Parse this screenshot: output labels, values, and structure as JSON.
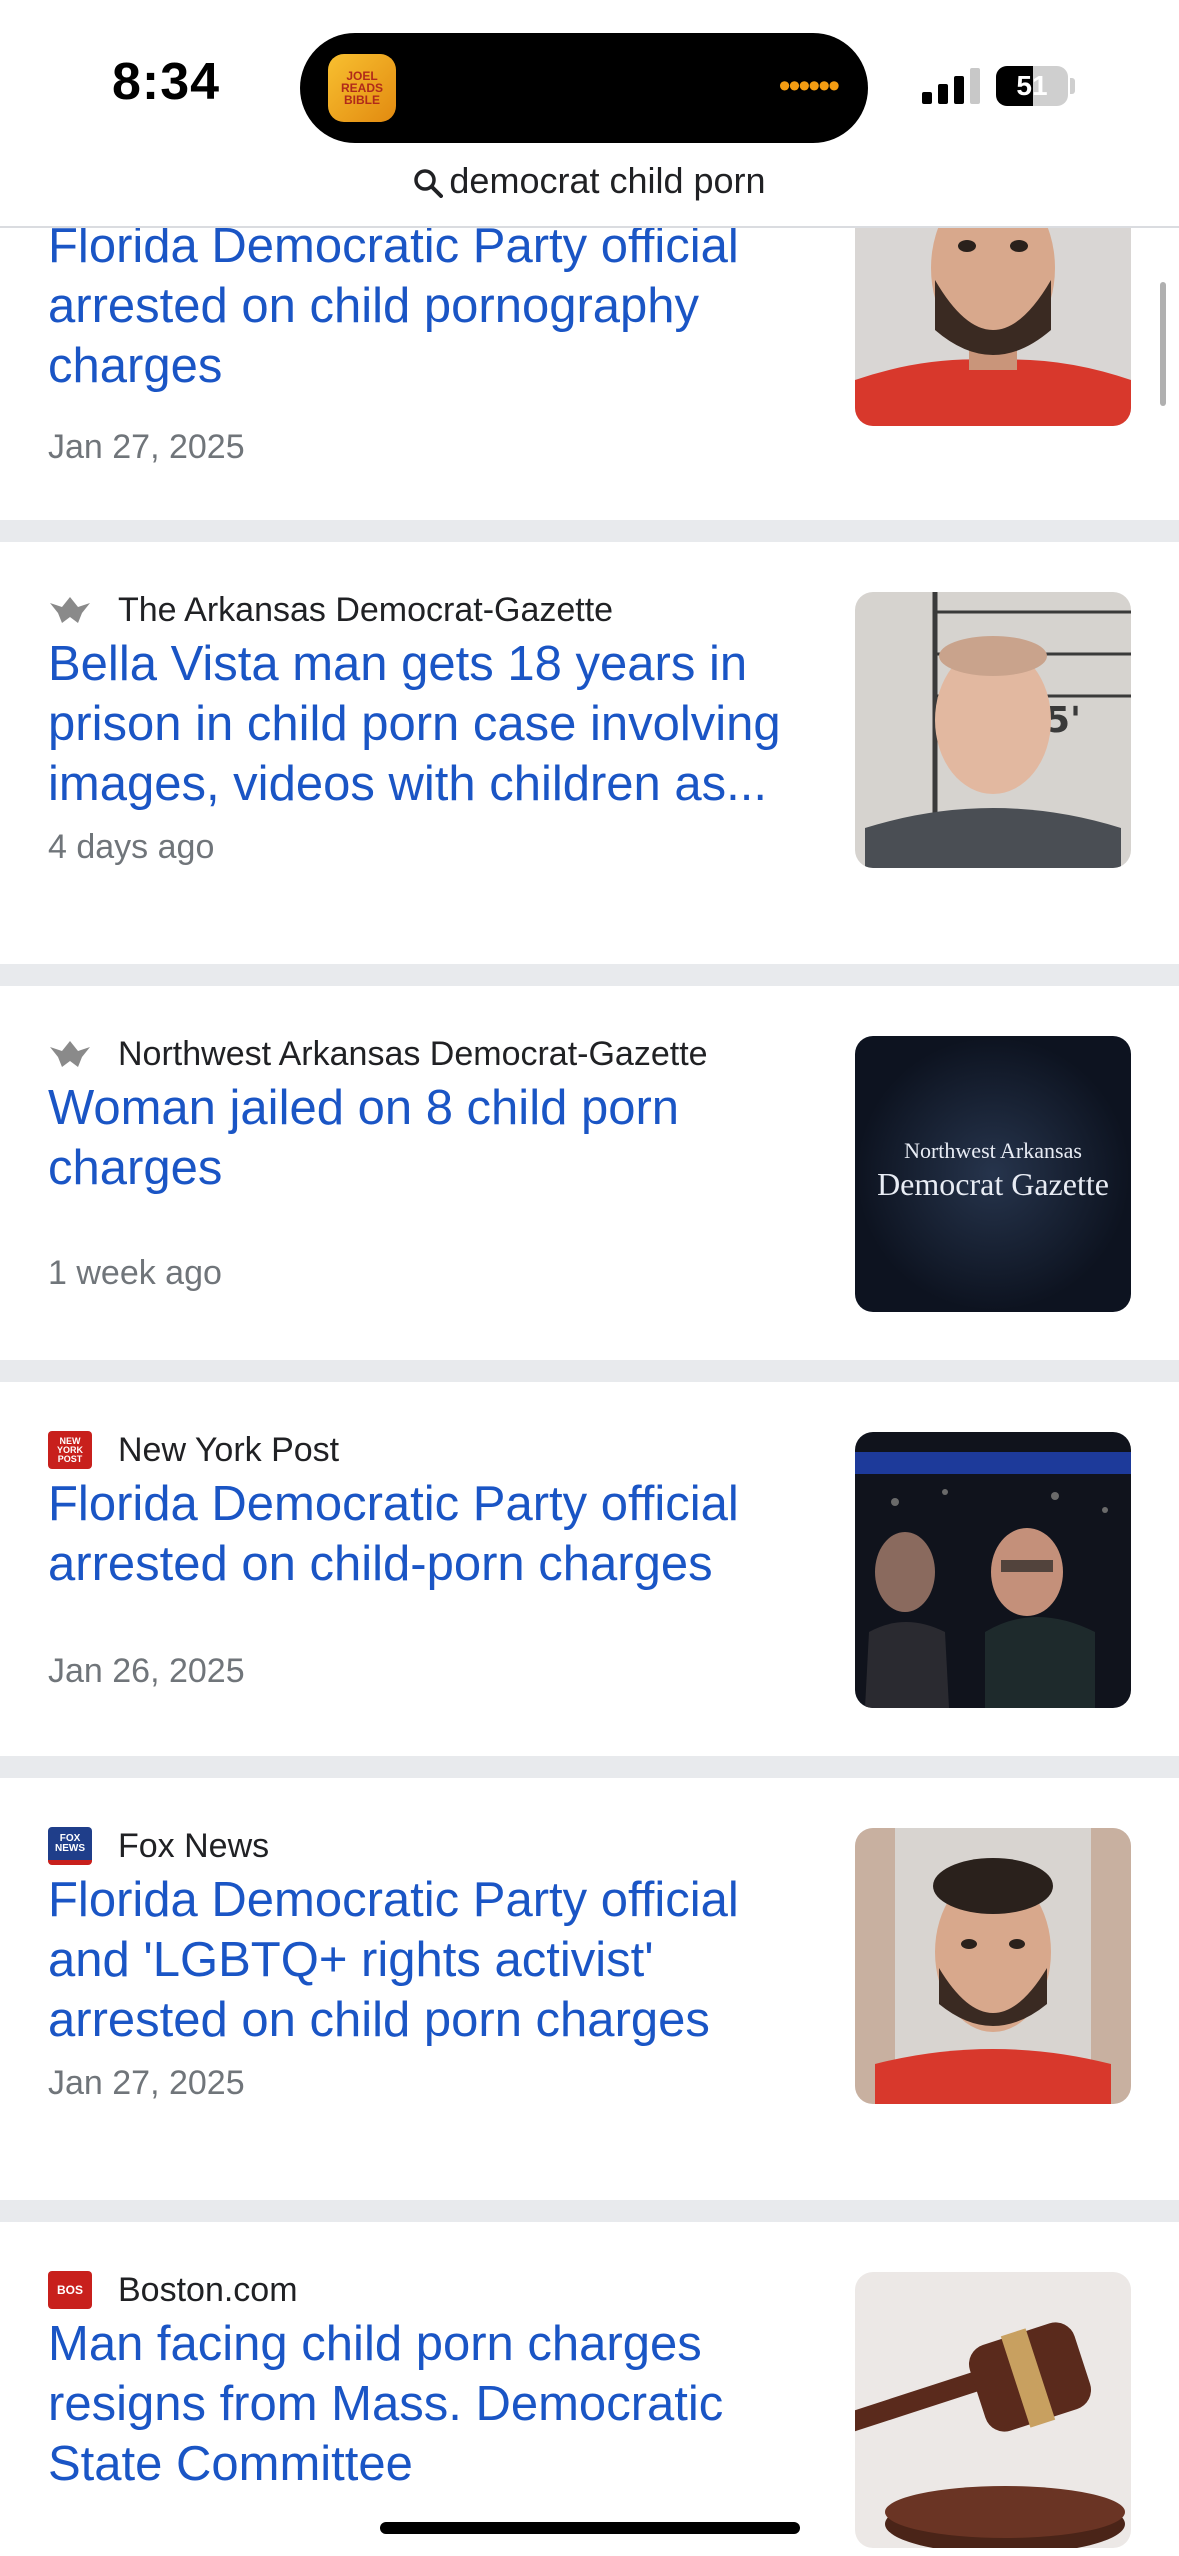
{
  "status": {
    "time": "8:34",
    "battery": "51",
    "island_app": "JOEL READS BIBLE"
  },
  "search": {
    "query": "democrat child porn"
  },
  "articles": [
    {
      "source": "",
      "title": "Florida Democratic Party official arrested on child pornography charges",
      "date": "Jan 27, 2025",
      "thumb": "mugshot-red-shirt"
    },
    {
      "source": "The Arkansas Democrat-Gazette",
      "title": "Bella Vista man gets 18 years in prison in child porn case involving images, videos with children as...",
      "date": "4 days ago",
      "thumb": "mugshot-height-chart",
      "thumb_text": "5'"
    },
    {
      "source": "Northwest Arkansas Democrat-Gazette",
      "title": "Woman jailed on 8 child porn charges",
      "date": "1 week ago",
      "thumb": "newspaper-logo",
      "thumb_text_1": "Northwest Arkansas",
      "thumb_text_2": "Democrat Gazette"
    },
    {
      "source": "New York Post",
      "title": "Florida Democratic Party official arrested on child-porn charges",
      "date": "Jan 26, 2025",
      "thumb": "arena-photo"
    },
    {
      "source": "Fox News",
      "title": "Florida Democratic Party official and 'LGBTQ+ rights activist' arrested on child porn charges",
      "date": "Jan 27, 2025",
      "thumb": "mugshot-red-shirt"
    },
    {
      "source": "Boston.com",
      "title": "Man facing child porn charges resigns from Mass. Democratic State Committee",
      "date": "",
      "thumb": "gavel"
    }
  ],
  "favicons": {
    "nypost": "NEW YORK POST",
    "fox": "FOX NEWS",
    "boston": "BOS"
  },
  "colors": {
    "link": "#1a55c5",
    "separator": "#e8eaed",
    "meta": "#70757a"
  }
}
